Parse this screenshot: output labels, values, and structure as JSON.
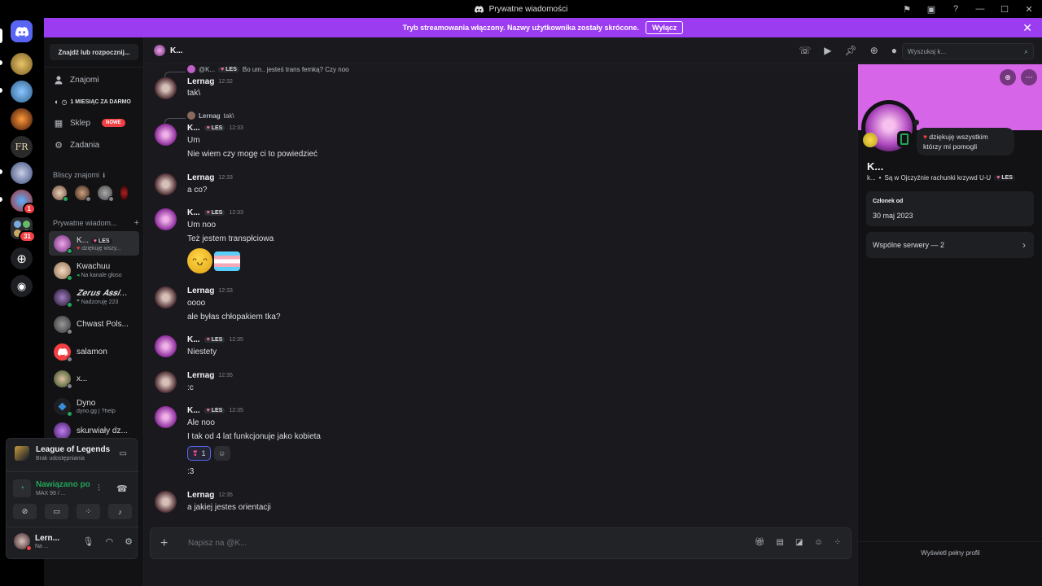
{
  "window": {
    "title": "Prywatne wiadomości"
  },
  "banner": {
    "text": "Tryb streamowania włączony. Nazwy użytkownika zostały skrócone.",
    "button_label": "Wyłącz",
    "close": "✕"
  },
  "rail": {
    "badges": [
      "1",
      "31"
    ]
  },
  "sidebar": {
    "find_button": "Znajdź lub rozpocznij...",
    "nav": [
      {
        "label": "Znajomi"
      },
      {
        "label": "Sklep",
        "badge": "NOWE"
      },
      {
        "label": "Zadania"
      }
    ],
    "promo": "1 MIESIĄC ZA DARMO",
    "close_friends_heading": "Bliscy znajomi",
    "dm_heading": "Prywatne wiadom...",
    "dms": [
      {
        "name": "K...",
        "tag": "LES",
        "sub": "dziękuję wszy..."
      },
      {
        "name": "Kwachuu",
        "sub": "Na kanale głoso"
      },
      {
        "name": "𝒁𝒆𝒓𝒖𝒔 𝑨𝒔𝒔𝒊...",
        "sub": "Nadzoruję 223"
      },
      {
        "name": "Chwast Pols...",
        "sub": ""
      },
      {
        "name": "salamon",
        "sub": ""
      },
      {
        "name": "x...",
        "sub": ""
      },
      {
        "name": "Dyno",
        "sub": "dyno.gg | ?help"
      },
      {
        "name": "skurwiały dz...",
        "sub": ""
      }
    ]
  },
  "activity": {
    "game": "League of Legends",
    "game_sub": "Brak udostępniania",
    "voice_status": "Nawiązano po",
    "voice_sub": "MAX 99 / ...",
    "user_name": "Lern...",
    "user_status": "Na ..."
  },
  "chat": {
    "title": "K...",
    "search_placeholder": "Wyszukaj k...",
    "composer_placeholder": "Napisz na @K...",
    "messages": [
      {
        "reply_name": "@K...",
        "reply_tag": "LES",
        "reply_text": "Bo um.. jesteś trans femką? Czy noo",
        "author": "Lernag",
        "time": "12:32",
        "lines": [
          "tak\\"
        ]
      },
      {
        "reply_name": "Lernag",
        "reply_text": "tak\\",
        "author": "K...",
        "tag": "LES",
        "time": "12:33",
        "lines": [
          "Um",
          "Nie wiem czy mogę ci to powiedzieć"
        ]
      },
      {
        "author": "Lernag",
        "time": "12:33",
        "lines": [
          "a co?"
        ]
      },
      {
        "author": "K...",
        "tag": "LES",
        "time": "12:33",
        "lines": [
          "Um noo",
          "Też jestem transpłciowa"
        ]
      },
      {
        "author": "Lernag",
        "time": "12:33",
        "lines": [
          "oooo",
          "ale byłas chłopakiem tka?"
        ]
      },
      {
        "author": "K...",
        "tag": "LES",
        "time": "12:35",
        "lines": [
          "Niestety"
        ]
      },
      {
        "author": "Lernag",
        "time": "12:35",
        "lines": [
          ":c"
        ]
      },
      {
        "author": "K...",
        "tag": "LES",
        "time": "12:35",
        "lines": [
          "Ale noo",
          "I tak od 4 lat funkcjonuje jako kobieta",
          ":3"
        ],
        "reaction_count": "1"
      },
      {
        "author": "Lernag",
        "time": "12:35",
        "lines": [
          "a jakiej jestes orientacji"
        ]
      }
    ]
  },
  "profile": {
    "status": "dziękuję wszystkim którzy mi pomogli",
    "name": "K...",
    "sub_user": "k...",
    "sub_bio": "Są w Ojczyźnie rachunki krzywd U-U",
    "tag": "LES",
    "member_label": "Członek od",
    "member_since": "30 maj 2023",
    "shared_servers": "Wspólne serwery — 2",
    "full_profile": "Wyświetl pełny profil"
  },
  "colors": {
    "accent": "#9b3cf0",
    "profile_banner": "#d665e8",
    "online": "#23a55a",
    "danger": "#f23f43",
    "blurple": "#5865f2"
  }
}
